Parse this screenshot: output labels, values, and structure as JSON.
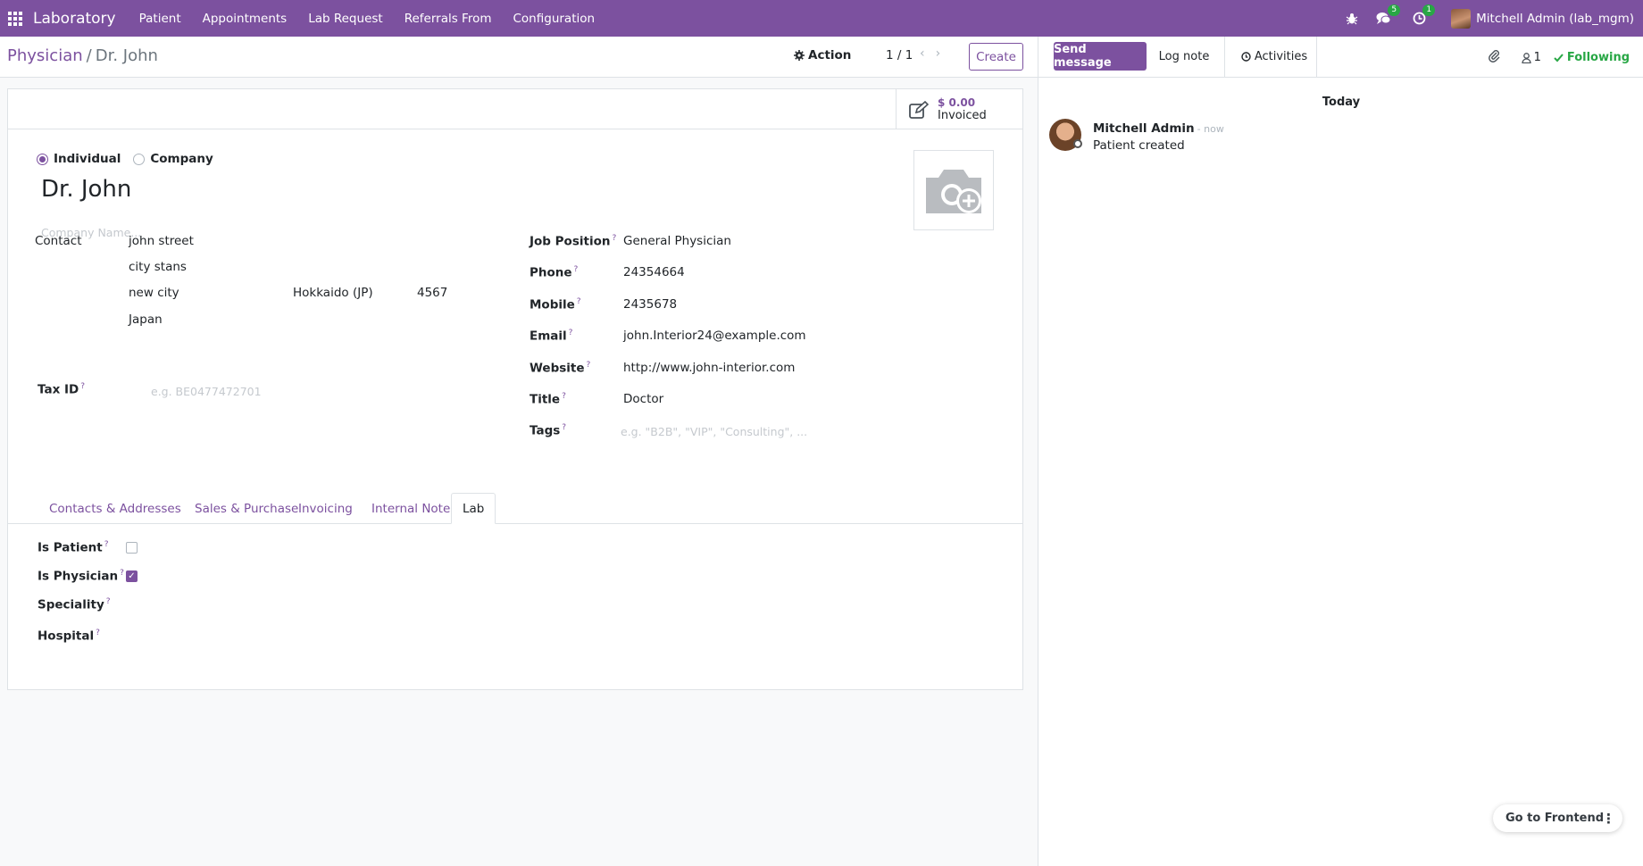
{
  "navbar": {
    "brand": "Laboratory",
    "menu": [
      "Patient",
      "Appointments",
      "Lab Request",
      "Referrals From",
      "Configuration"
    ],
    "messages_badge": "5",
    "activities_badge": "1",
    "user": "Mitchell Admin (lab_mgm)"
  },
  "control_panel": {
    "breadcrumb_parent": "Physician",
    "breadcrumb_sep": "/",
    "breadcrumb_current": "Dr. John",
    "action_label": "Action",
    "pager": "1 / 1",
    "create_label": "Create"
  },
  "stat_button": {
    "value": "$ 0.00",
    "label": "Invoiced"
  },
  "form": {
    "type_individual": "Individual",
    "type_company": "Company",
    "name": "Dr. John",
    "company_placeholder": "Company Name...",
    "contact_label": "Contact",
    "street": "john street",
    "street2": "city stans",
    "city": "new city",
    "state": "Hokkaido (JP)",
    "zip": "4567",
    "country": "Japan",
    "tax_id_label": "Tax ID",
    "tax_id_placeholder": "e.g. BE0477472701",
    "job_position_label": "Job Position",
    "job_position": "General Physician",
    "phone_label": "Phone",
    "phone": "24354664",
    "mobile_label": "Mobile",
    "mobile": "2435678",
    "email_label": "Email",
    "email": "john.Interior24@example.com",
    "website_label": "Website",
    "website": "http://www.john-interior.com",
    "title_label": "Title",
    "title": "Doctor",
    "tags_label": "Tags",
    "tags_placeholder": "e.g. \"B2B\", \"VIP\", \"Consulting\", ...",
    "help_mark": "?"
  },
  "tabs": [
    "Contacts & Addresses",
    "Sales & Purchase",
    "Invoicing",
    "Internal Notes",
    "Lab"
  ],
  "lab_tab": {
    "is_patient_label": "Is Patient",
    "is_patient": false,
    "is_physician_label": "Is Physician",
    "is_physician": true,
    "speciality_label": "Speciality",
    "hospital_label": "Hospital"
  },
  "chatter": {
    "send_message": "Send message",
    "log_note": "Log note",
    "activities": "Activities",
    "followers_count": "1",
    "following": "Following",
    "date_separator": "Today",
    "message_author": "Mitchell Admin",
    "message_time": "- now",
    "message_body": "Patient created"
  },
  "frontend_button": "Go to Frontend",
  "colors": {
    "brand": "#7c519f",
    "success": "#28a745"
  }
}
